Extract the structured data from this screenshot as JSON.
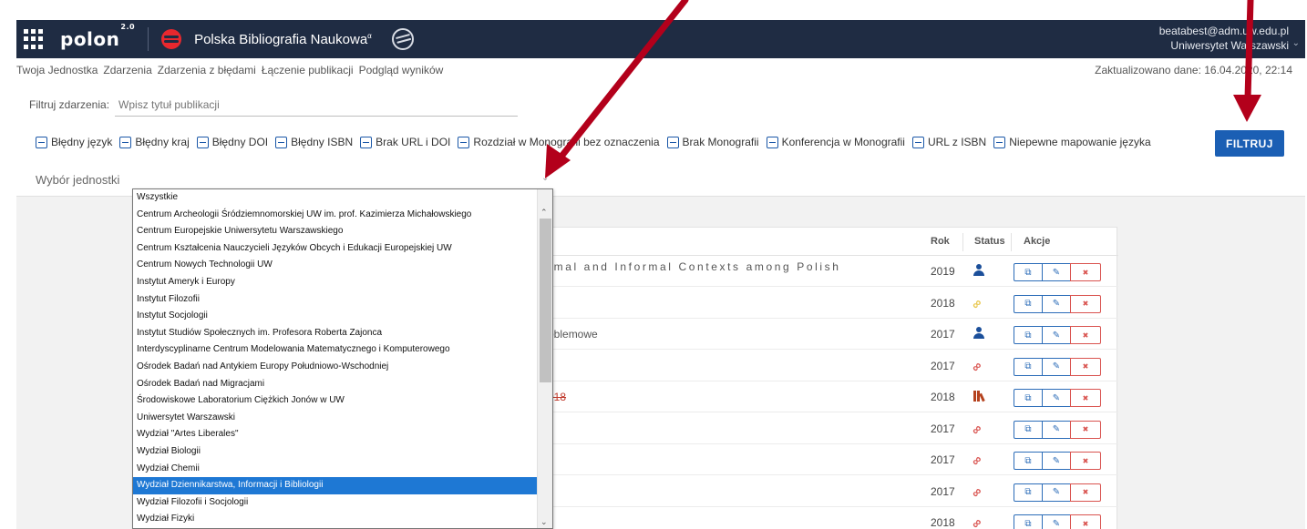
{
  "header": {
    "logo_text": "polon",
    "logo_sup": "2.0",
    "app_title": "Polska Bibliografia Naukowa",
    "app_title_sup": "α",
    "user_email": "beatabest@adm.uw.edu.pl",
    "user_unit": "Uniwersytet Warszawski"
  },
  "nav": {
    "items": [
      "Twoja Jednostka",
      "Zdarzenia",
      "Zdarzenia z błędami",
      "Łączenie publikacji",
      "Podgląd wyników"
    ],
    "updated": "Zaktualizowano dane: 16.04.2020, 22:14"
  },
  "filter": {
    "label": "Filtruj zdarzenia:",
    "placeholder": "Wpisz tytuł publikacji",
    "checkboxes": [
      "Błędny język",
      "Błędny kraj",
      "Błędny DOI",
      "Błędny ISBN",
      "Brak URL i DOI",
      "Rozdział w Monografii bez oznaczenia",
      "Brak Monografii",
      "Konferencja w Monografii",
      "URL z ISBN",
      "Niepewne mapowanie języka"
    ],
    "button": "FILTRUJ",
    "unit_label": "Wybór jednostki"
  },
  "table": {
    "headers": {
      "year": "Rok",
      "status": "Status",
      "actions": "Akcje"
    },
    "rows": [
      {
        "title": "rmal and Informal Contexts among Polish",
        "year": "2019",
        "status": "person"
      },
      {
        "title": "",
        "year": "2018",
        "status": "link-yellow"
      },
      {
        "title": "oblemowe",
        "year": "2017",
        "status": "person"
      },
      {
        "title": "",
        "year": "2017",
        "status": "link"
      },
      {
        "title": "018",
        "year": "2018",
        "status": "books"
      },
      {
        "title": "",
        "year": "2017",
        "status": "link"
      },
      {
        "title": "",
        "year": "2017",
        "status": "link"
      },
      {
        "title": "",
        "year": "2017",
        "status": "link"
      },
      {
        "title": "",
        "year": "2018",
        "status": "link"
      }
    ],
    "action_icons": [
      "open-external-icon",
      "edit-pencil-icon",
      "trash-icon"
    ]
  },
  "dropdown": {
    "selected": "Wydział Dziennikarstwa, Informacji i Bibliologii",
    "options": [
      "Wszystkie",
      "Centrum Archeologii Śródziemnomorskiej UW im. prof. Kazimierza Michałowskiego",
      "Centrum Europejskie Uniwersytetu Warszawskiego",
      "Centrum Kształcenia Nauczycieli Języków Obcych i Edukacji Europejskiej UW",
      "Centrum Nowych Technologii UW",
      "Instytut Ameryk i Europy",
      "Instytut Filozofii",
      "Instytut Socjologii",
      "Instytut Studiów Społecznych im. Profesora Roberta Zajonca",
      "Interdyscyplinarne Centrum Modelowania Matematycznego i Komputerowego",
      "Ośrodek Badań nad Antykiem Europy Południowo-Wschodniej",
      "Ośrodek Badań nad Migracjami",
      "Środowiskowe Laboratorium Ciężkich Jonów w UW",
      "Uniwersytet Warszawski",
      "Wydział \"Artes Liberales\"",
      "Wydział Biologii",
      "Wydział Chemii",
      "Wydział Dziennikarstwa, Informacji i Bibliologii",
      "Wydział Filozofii i Socjologii",
      "Wydział Fizyki"
    ]
  },
  "colors": {
    "header_bg": "#1f2c43",
    "primary_button": "#1b5fb4",
    "selection": "#1e78d4",
    "annotation_arrow": "#b3001b",
    "delete": "#d9534f"
  }
}
